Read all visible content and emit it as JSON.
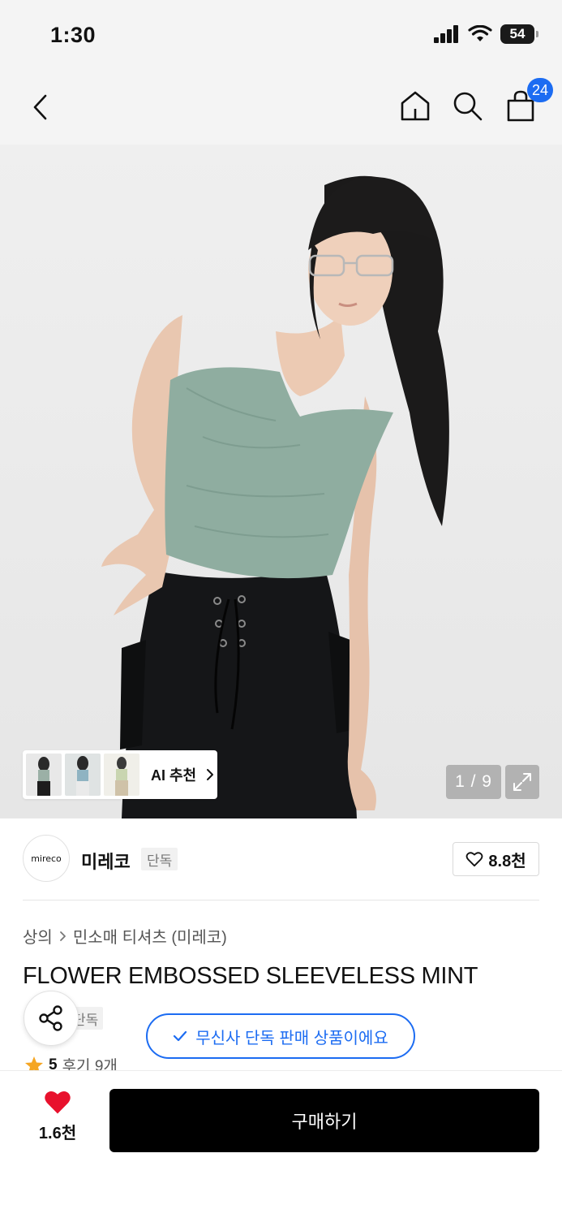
{
  "status_bar": {
    "time": "1:30",
    "battery": "54"
  },
  "nav": {
    "cart_count": "24"
  },
  "gallery": {
    "ai_label": "AI 추천",
    "counter": "1 / 9"
  },
  "brand": {
    "logo_text": "mireco",
    "name": "미레코",
    "tag": "단독",
    "likes": "8.8천"
  },
  "product": {
    "breadcrumb": [
      "상의",
      "민소매 티셔츠 (미레코)"
    ],
    "title": "FLOWER EMBOSSED SLEEVELESS MINT",
    "tag": "단독",
    "rating": "5",
    "reviews": "후기 9개"
  },
  "toast": {
    "text": "무신사 단독 판매 상품이에요"
  },
  "bottom": {
    "like_count": "1.6천",
    "buy_label": "구매하기"
  },
  "colors": {
    "accent": "#1c6cf2",
    "heart": "#e8112d",
    "star": "#f5a623"
  }
}
